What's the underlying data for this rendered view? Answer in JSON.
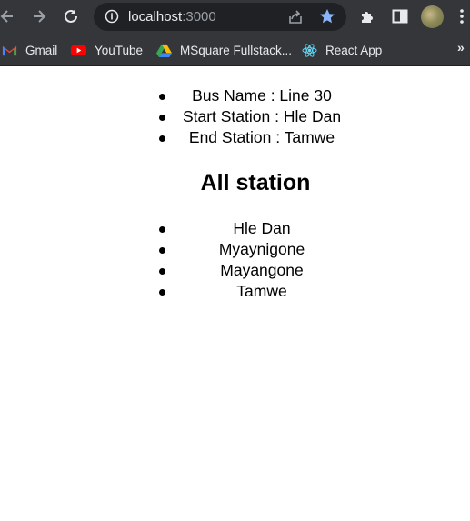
{
  "browser": {
    "url_host": "localhost",
    "url_port": ":3000",
    "bookmarks": [
      {
        "label": "Gmail",
        "icon": "gmail-icon"
      },
      {
        "label": "YouTube",
        "icon": "youtube-icon"
      },
      {
        "label": "MSquare Fullstack...",
        "icon": "google-drive-icon"
      },
      {
        "label": "React App",
        "icon": "react-icon"
      }
    ],
    "more_bookmarks": "»"
  },
  "bus": {
    "items": [
      "Bus Name : Line 30",
      "Start Station : Hle Dan",
      "End Station : Tamwe"
    ]
  },
  "stations": {
    "heading": "All station",
    "items": [
      "Hle Dan",
      "Myaynigone",
      "Mayangone",
      "Tamwe"
    ]
  }
}
